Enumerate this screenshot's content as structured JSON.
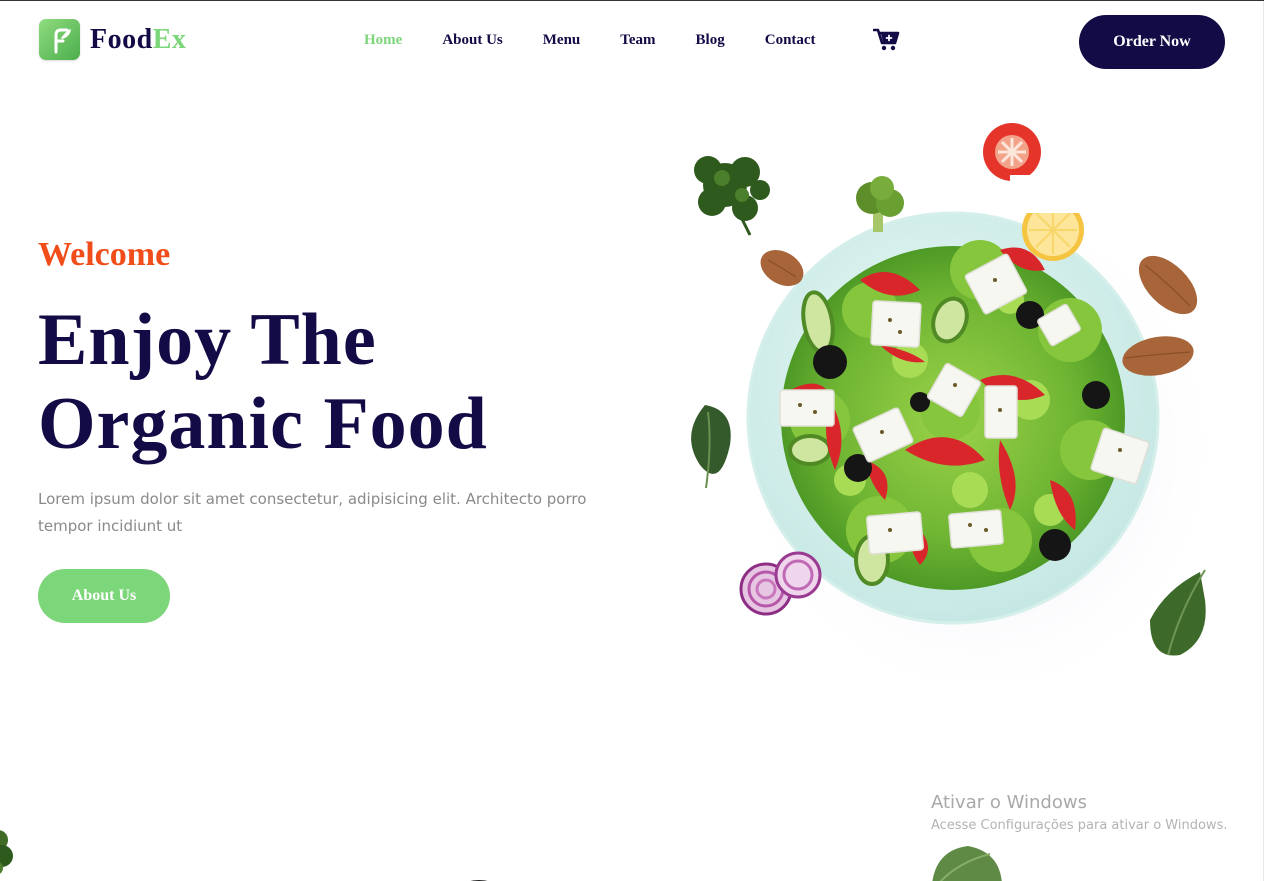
{
  "brand": {
    "name_part1": "Food",
    "name_part2": "Ex",
    "accent": "#7cd67a",
    "navy": "#120b46"
  },
  "nav": {
    "items": [
      {
        "label": "Home",
        "active": true
      },
      {
        "label": "About Us",
        "active": false
      },
      {
        "label": "Menu",
        "active": false
      },
      {
        "label": "Team",
        "active": false
      },
      {
        "label": "Blog",
        "active": false
      },
      {
        "label": "Contact",
        "active": false
      }
    ],
    "cart_icon": "cart-plus-icon",
    "cta_label": "Order Now"
  },
  "hero": {
    "eyebrow": "Welcome",
    "title_line1": "Enjoy The",
    "title_line2": "Organic Food",
    "description": "Lorem ipsum dolor sit amet consectetur, adipisicing elit. Architecto porro tempor incidiunt ut",
    "button_label": "About Us",
    "eyebrow_color": "#f04d1a"
  },
  "watermark": {
    "title": "Ativar o Windows",
    "subtitle": "Acesse Configurações para ativar o Windows."
  }
}
